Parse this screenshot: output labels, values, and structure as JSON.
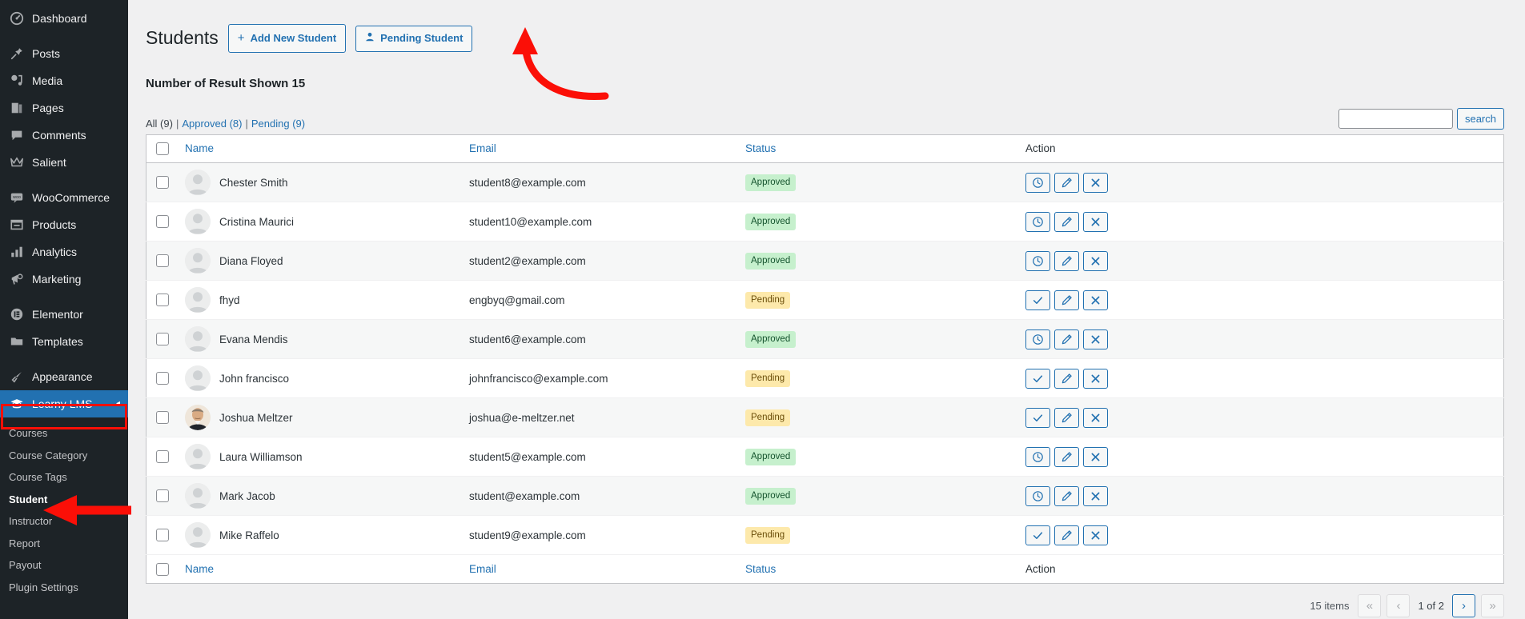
{
  "sidebar": {
    "items": [
      {
        "label": "Dashboard",
        "icon": "dashboard-icon"
      },
      {
        "label": "Posts",
        "icon": "pin-icon"
      },
      {
        "label": "Media",
        "icon": "media-icon"
      },
      {
        "label": "Pages",
        "icon": "pages-icon"
      },
      {
        "label": "Comments",
        "icon": "comments-icon"
      },
      {
        "label": "Salient",
        "icon": "crown-icon"
      },
      {
        "label": "WooCommerce",
        "icon": "woocommerce-icon"
      },
      {
        "label": "Products",
        "icon": "products-icon"
      },
      {
        "label": "Analytics",
        "icon": "analytics-icon"
      },
      {
        "label": "Marketing",
        "icon": "megaphone-icon"
      },
      {
        "label": "Elementor",
        "icon": "elementor-icon"
      },
      {
        "label": "Templates",
        "icon": "folder-icon"
      },
      {
        "label": "Appearance",
        "icon": "brush-icon"
      },
      {
        "label": "Learny LMS",
        "icon": "graduation-cap-icon"
      }
    ],
    "current_item": "Learny LMS",
    "collapse_caret": "◂",
    "submenu": [
      {
        "label": "Courses"
      },
      {
        "label": "Course Category"
      },
      {
        "label": "Course Tags"
      },
      {
        "label": "Student"
      },
      {
        "label": "Instructor"
      },
      {
        "label": "Report"
      },
      {
        "label": "Payout"
      },
      {
        "label": "Plugin Settings"
      }
    ],
    "submenu_active": "Student"
  },
  "header": {
    "title": "Students",
    "add_new_label": "Add New Student",
    "add_new_plus": "+",
    "pending_label": "Pending Student",
    "subtitle": "Number of Result Shown 15"
  },
  "filters": {
    "all": {
      "label": "All (9)"
    },
    "approved": {
      "label": "Approved (8)"
    },
    "pending": {
      "label": "Pending (9)"
    },
    "separator": "|"
  },
  "search": {
    "value": "",
    "placeholder": "",
    "button_label": "search"
  },
  "table": {
    "columns": {
      "name": "Name",
      "email": "Email",
      "status": "Status",
      "action": "Action"
    },
    "rows": [
      {
        "name": "Chester Smith",
        "email": "student8@example.com",
        "status": "Approved",
        "avatar": "placeholder",
        "first_action": "clock-icon"
      },
      {
        "name": "Cristina Maurici",
        "email": "student10@example.com",
        "status": "Approved",
        "avatar": "placeholder",
        "first_action": "clock-icon"
      },
      {
        "name": "Diana Floyed",
        "email": "student2@example.com",
        "status": "Approved",
        "avatar": "placeholder",
        "first_action": "clock-icon"
      },
      {
        "name": "fhyd",
        "email": "engbyq@gmail.com",
        "status": "Pending",
        "avatar": "placeholder",
        "first_action": "check-icon"
      },
      {
        "name": "Evana Mendis",
        "email": "student6@example.com",
        "status": "Approved",
        "avatar": "placeholder",
        "first_action": "clock-icon"
      },
      {
        "name": "John francisco",
        "email": "johnfrancisco@example.com",
        "status": "Pending",
        "avatar": "placeholder",
        "first_action": "check-icon"
      },
      {
        "name": "Joshua Meltzer",
        "email": "joshua@e-meltzer.net",
        "status": "Pending",
        "avatar": "photo",
        "first_action": "check-icon"
      },
      {
        "name": "Laura Williamson",
        "email": "student5@example.com",
        "status": "Approved",
        "avatar": "placeholder",
        "first_action": "clock-icon"
      },
      {
        "name": "Mark Jacob",
        "email": "student@example.com",
        "status": "Approved",
        "avatar": "placeholder",
        "first_action": "clock-icon"
      },
      {
        "name": "Mike Raffelo",
        "email": "student9@example.com",
        "status": "Pending",
        "avatar": "placeholder",
        "first_action": "check-icon"
      }
    ]
  },
  "pagination": {
    "items_label": "15 items",
    "first": "«",
    "prev": "‹",
    "page_text": "1 of 2",
    "next": "›",
    "last": "»"
  },
  "colors": {
    "sidebar_bg": "#1d2327",
    "accent_blue": "#2271b1",
    "current_item_bg": "#2271b1",
    "annotation_red": "#fb0f07",
    "approved_bg": "#c6f0cd",
    "pending_bg": "#fde9ab"
  }
}
